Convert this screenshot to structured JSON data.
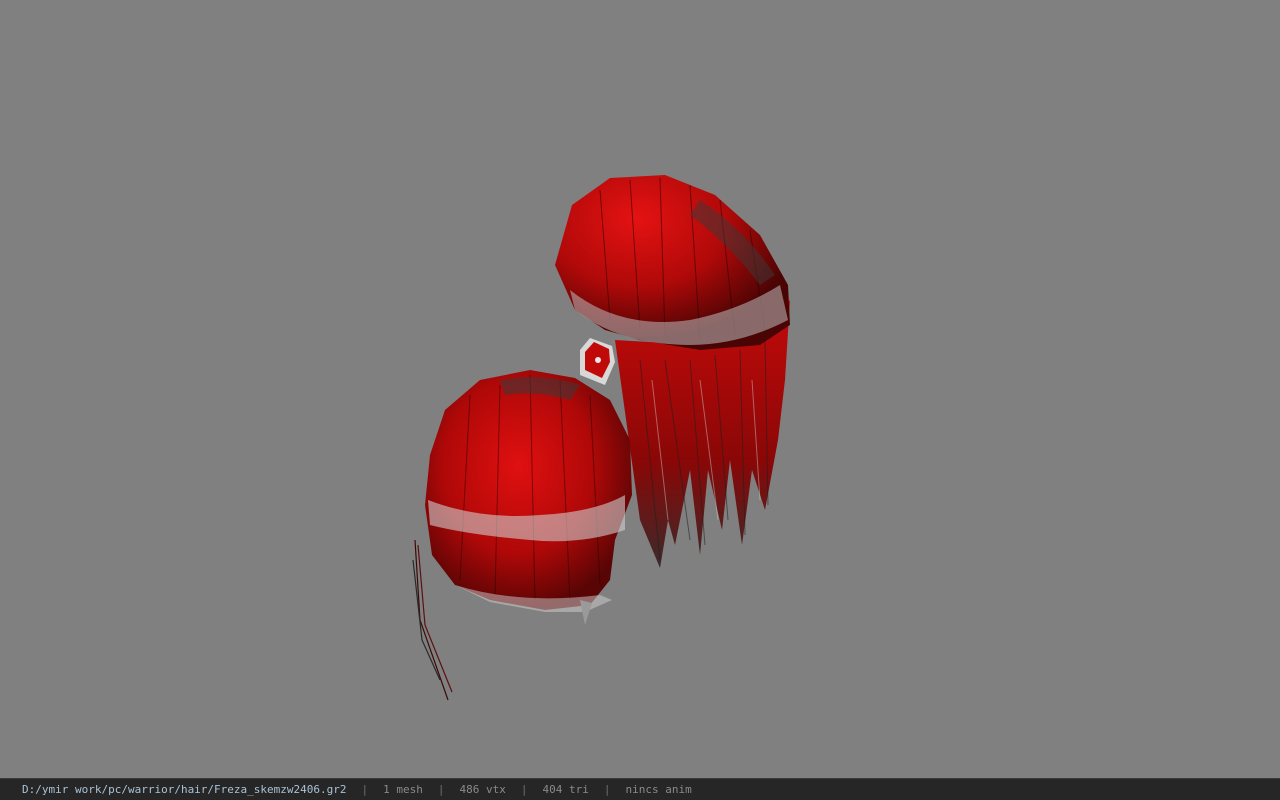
{
  "viewport": {
    "background_color": "#808080",
    "model_colors": {
      "hair_red": "#cc0b0b",
      "hair_dark_red": "#6e0606",
      "hair_highlight": "#d8d8d8",
      "hair_shadow": "#2a2a2a"
    }
  },
  "statusbar": {
    "file_path": "D:/ymir work/pc/warrior/hair/Freza_skemzw2406.gr2",
    "separator": "|",
    "mesh_count": "1 mesh",
    "vertex_count": "486 vtx",
    "triangle_count": "404 tri",
    "anim_status": "nincs anim"
  }
}
